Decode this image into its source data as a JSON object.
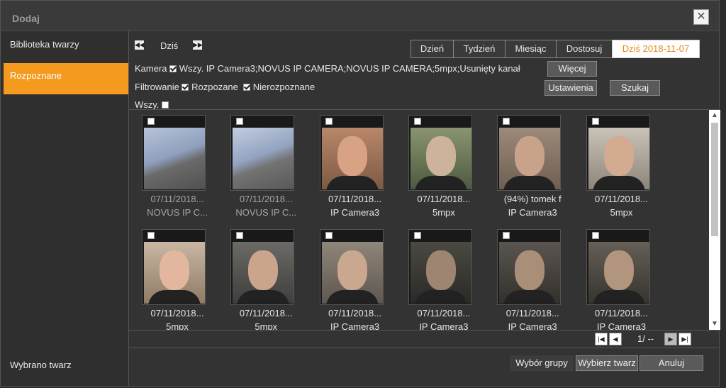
{
  "dialog": {
    "title": "Dodaj",
    "close_icon": "close-icon"
  },
  "sidebar": {
    "items": [
      {
        "label": "Biblioteka twarzy",
        "active": false
      },
      {
        "label": "Rozpoznane",
        "active": true
      }
    ],
    "footer": "Wybrano twarz"
  },
  "toolbar": {
    "today_label": "Dziś",
    "tabs": [
      {
        "label": "Dzień",
        "active": false
      },
      {
        "label": "Tydzień",
        "active": false
      },
      {
        "label": "Miesiąc",
        "active": false
      },
      {
        "label": "Dostosuj",
        "active": false
      },
      {
        "label": "Dziś 2018-11-07",
        "active": true
      }
    ]
  },
  "filters": {
    "camera_label": "Kamera",
    "camera_checked": true,
    "camera_value": "Wszy. IP Camera3;NOVUS IP CAMERA;NOVUS IP CAMERA;5mpx;Usunięty kanał",
    "filter_label": "Filtrowanie",
    "recognized_label": "Rozpozane",
    "recognized_checked": true,
    "unrecognized_label": "Nierozpoznane",
    "unrecognized_checked": true,
    "all_label": "Wszy.",
    "all_checked": false,
    "more_button": "Więcej",
    "settings_button": "Ustawienia",
    "search_button": "Szukaj"
  },
  "results": [
    {
      "date": "07/11/2018...",
      "label": "NOVUS IP C...",
      "muted": true
    },
    {
      "date": "07/11/2018...",
      "label": "NOVUS IP C...",
      "muted": true
    },
    {
      "date": "07/11/2018...",
      "label": "IP Camera3",
      "muted": false
    },
    {
      "date": "07/11/2018...",
      "label": "5mpx",
      "muted": false
    },
    {
      "date": "(94%) tomek f",
      "label": "IP Camera3",
      "muted": false
    },
    {
      "date": "07/11/2018...",
      "label": "5mpx",
      "muted": false
    },
    {
      "date": "07/11/2018...",
      "label": "5mpx",
      "muted": false
    },
    {
      "date": "07/11/2018...",
      "label": "5mpx",
      "muted": false
    },
    {
      "date": "07/11/2018...",
      "label": "IP Camera3",
      "muted": false
    },
    {
      "date": "07/11/2018...",
      "label": "IP Camera3",
      "muted": false
    },
    {
      "date": "07/11/2018...",
      "label": "IP Camera3",
      "muted": false
    },
    {
      "date": "07/11/2018...",
      "label": "IP Camera3",
      "muted": false
    }
  ],
  "pager": {
    "text": "1/ --"
  },
  "footer": {
    "group_button": "Wybór grupy",
    "select_face_button": "Wybierz twarz",
    "cancel_button": "Anuluj"
  },
  "colors": {
    "accent": "#f39a1f",
    "tab_active_text": "#e28a1a",
    "background": "#333333"
  }
}
